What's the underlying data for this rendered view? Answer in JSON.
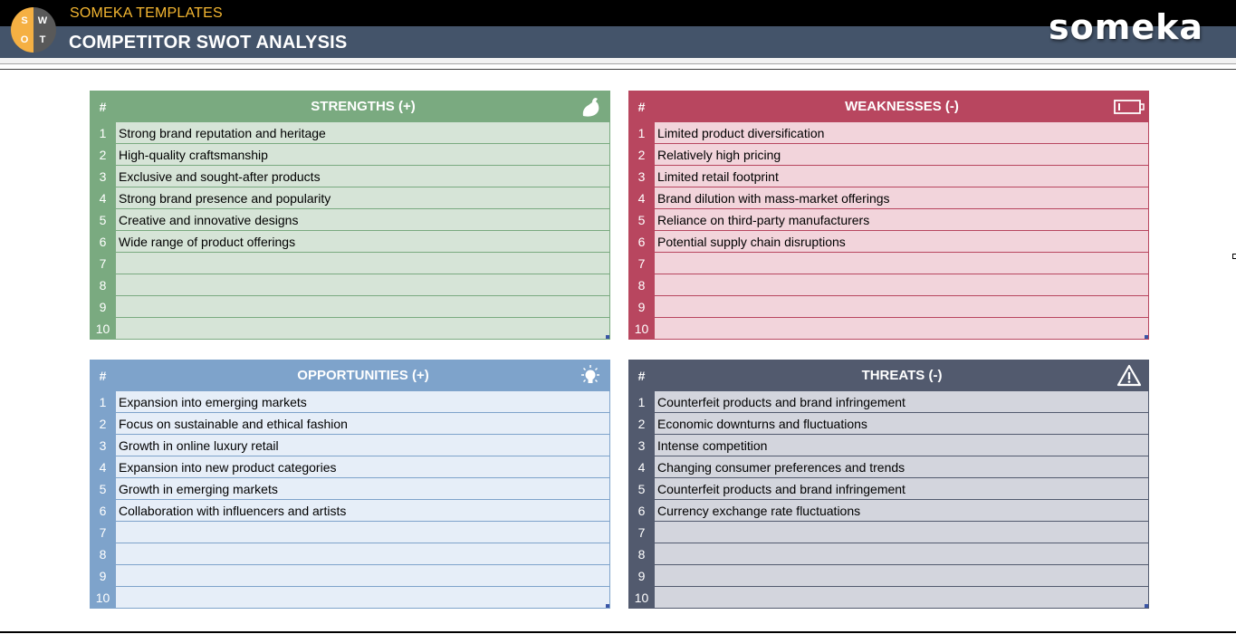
{
  "header": {
    "brand": "SOMEKA TEMPLATES",
    "title": "COMPETITOR SWOT ANALYSIS",
    "logo_letters": [
      "S",
      "W",
      "O",
      "T"
    ],
    "company_logo": "someka"
  },
  "colors": {
    "strengths": "#7aaa80",
    "weaknesses": "#b8465f",
    "opportunities": "#7ea3cb",
    "threats": "#525a6e",
    "brand_accent": "#f5b731",
    "title_bar": "#44546a"
  },
  "boxes": {
    "strengths": {
      "hash": "#",
      "title": "STRENGTHS (+)",
      "icon": "flexed-arm-icon",
      "rows": [
        {
          "n": "1",
          "text": "Strong brand reputation and heritage"
        },
        {
          "n": "2",
          "text": "High-quality craftsmanship"
        },
        {
          "n": "3",
          "text": "Exclusive and sought-after products"
        },
        {
          "n": "4",
          "text": "Strong brand presence and popularity"
        },
        {
          "n": "5",
          "text": "Creative and innovative designs"
        },
        {
          "n": "6",
          "text": "Wide range of product offerings"
        },
        {
          "n": "7",
          "text": ""
        },
        {
          "n": "8",
          "text": ""
        },
        {
          "n": "9",
          "text": ""
        },
        {
          "n": "10",
          "text": ""
        }
      ]
    },
    "weaknesses": {
      "hash": "#",
      "title": "WEAKNESSES (-)",
      "icon": "low-battery-icon",
      "rows": [
        {
          "n": "1",
          "text": "Limited product diversification"
        },
        {
          "n": "2",
          "text": "Relatively high pricing"
        },
        {
          "n": "3",
          "text": "Limited retail footprint"
        },
        {
          "n": "4",
          "text": "Brand dilution with mass-market offerings"
        },
        {
          "n": "5",
          "text": "Reliance on third-party manufacturers"
        },
        {
          "n": "6",
          "text": "Potential supply chain disruptions"
        },
        {
          "n": "7",
          "text": ""
        },
        {
          "n": "8",
          "text": ""
        },
        {
          "n": "9",
          "text": ""
        },
        {
          "n": "10",
          "text": ""
        }
      ]
    },
    "opportunities": {
      "hash": "#",
      "title": "OPPORTUNITIES (+)",
      "icon": "lightbulb-icon",
      "rows": [
        {
          "n": "1",
          "text": "Expansion into emerging markets"
        },
        {
          "n": "2",
          "text": "Focus on sustainable and ethical fashion"
        },
        {
          "n": "3",
          "text": "Growth in online luxury retail"
        },
        {
          "n": "4",
          "text": "Expansion into new product categories"
        },
        {
          "n": "5",
          "text": "Growth in emerging markets"
        },
        {
          "n": "6",
          "text": "Collaboration with influencers and artists"
        },
        {
          "n": "7",
          "text": ""
        },
        {
          "n": "8",
          "text": ""
        },
        {
          "n": "9",
          "text": ""
        },
        {
          "n": "10",
          "text": ""
        }
      ]
    },
    "threats": {
      "hash": "#",
      "title": "THREATS (-)",
      "icon": "warning-icon",
      "rows": [
        {
          "n": "1",
          "text": "Counterfeit products and brand infringement"
        },
        {
          "n": "2",
          "text": "Economic downturns and fluctuations"
        },
        {
          "n": "3",
          "text": "Intense competition"
        },
        {
          "n": "4",
          "text": "Changing consumer preferences and trends"
        },
        {
          "n": "5",
          "text": "Counterfeit products and brand infringement"
        },
        {
          "n": "6",
          "text": "Currency exchange rate fluctuations"
        },
        {
          "n": "7",
          "text": ""
        },
        {
          "n": "8",
          "text": ""
        },
        {
          "n": "9",
          "text": ""
        },
        {
          "n": "10",
          "text": ""
        }
      ]
    }
  }
}
